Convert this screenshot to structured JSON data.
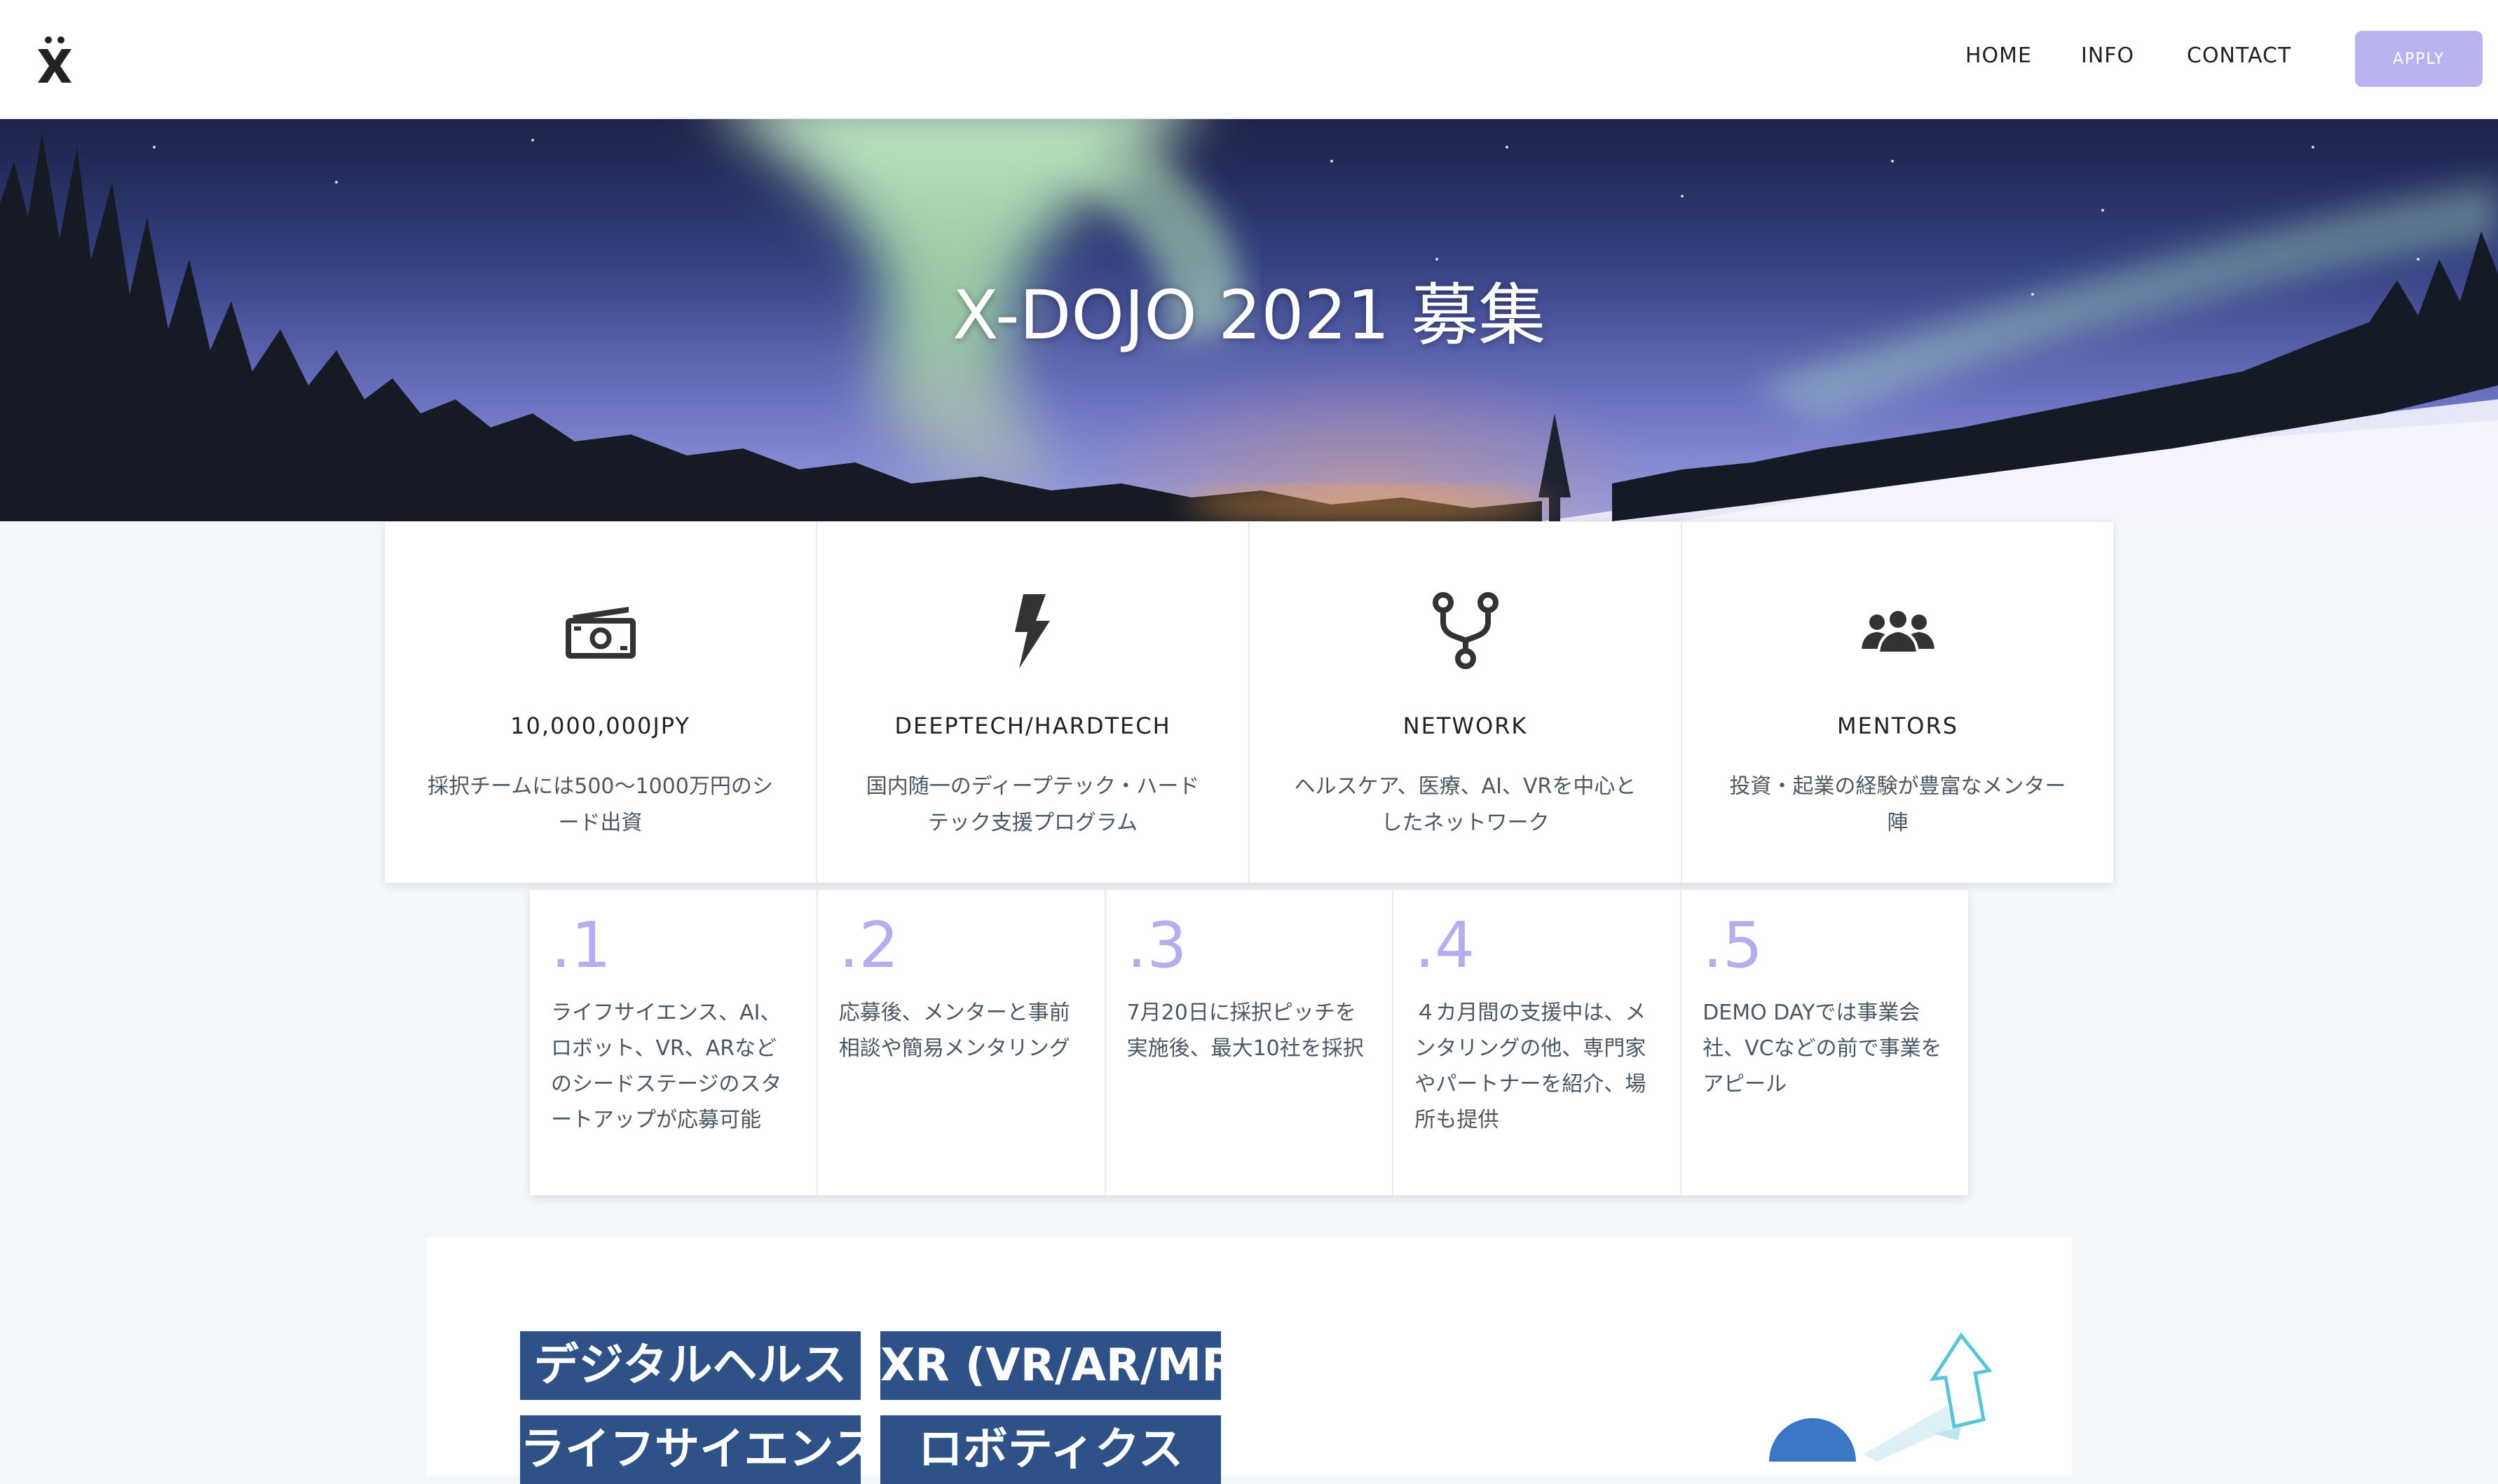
{
  "nav": {
    "logo_alt": "X-DOJO logo",
    "home": "HOME",
    "info": "INFO",
    "contact": "CONTACT",
    "apply": "APPLY"
  },
  "hero": {
    "title": "X-DOJO 2021 募集"
  },
  "features": [
    {
      "icon": "money-icon",
      "title": "10,000,000JPY",
      "desc": "採択チームには500〜1000万円のシード出資"
    },
    {
      "icon": "lightning-icon",
      "title": "DEEPTECH/HARDTECH",
      "desc": "国内随一のディープテック・ハードテック支援プログラム"
    },
    {
      "icon": "network-fork-icon",
      "title": "NETWORK",
      "desc": "ヘルスケア、医療、AI、VRを中心としたネットワーク"
    },
    {
      "icon": "mentors-icon",
      "title": "MENTORS",
      "desc": "投資・起業の経験が豊富なメンター陣"
    }
  ],
  "steps": [
    {
      "num": ".1",
      "text": "ライフサイエンス、AI、ロボット、VR、ARなどのシードステージのスタートアップが応募可能"
    },
    {
      "num": ".2",
      "text": "応募後、メンターと事前相談や簡易メンタリング"
    },
    {
      "num": ".3",
      "text": "7月20日に採択ピッチを実施後、最大10社を採択"
    },
    {
      "num": ".4",
      "text": "４カ月間の支援中は、メンタリングの他、専門家やパートナーを紹介、場所も提供"
    },
    {
      "num": ".5",
      "text": "DEMO DAYでは事業会社、VCなどの前で事業をアピール"
    }
  ],
  "tags": [
    "デジタルヘルス",
    "XR (VR/AR/MR)",
    "ライフサイエンス",
    "ロボティクス"
  ],
  "colors": {
    "accent": "#b9b3ef",
    "step_number": "#b3aeee",
    "tag_bg": "#2e5187",
    "body_bg": "#f5f8fb"
  }
}
